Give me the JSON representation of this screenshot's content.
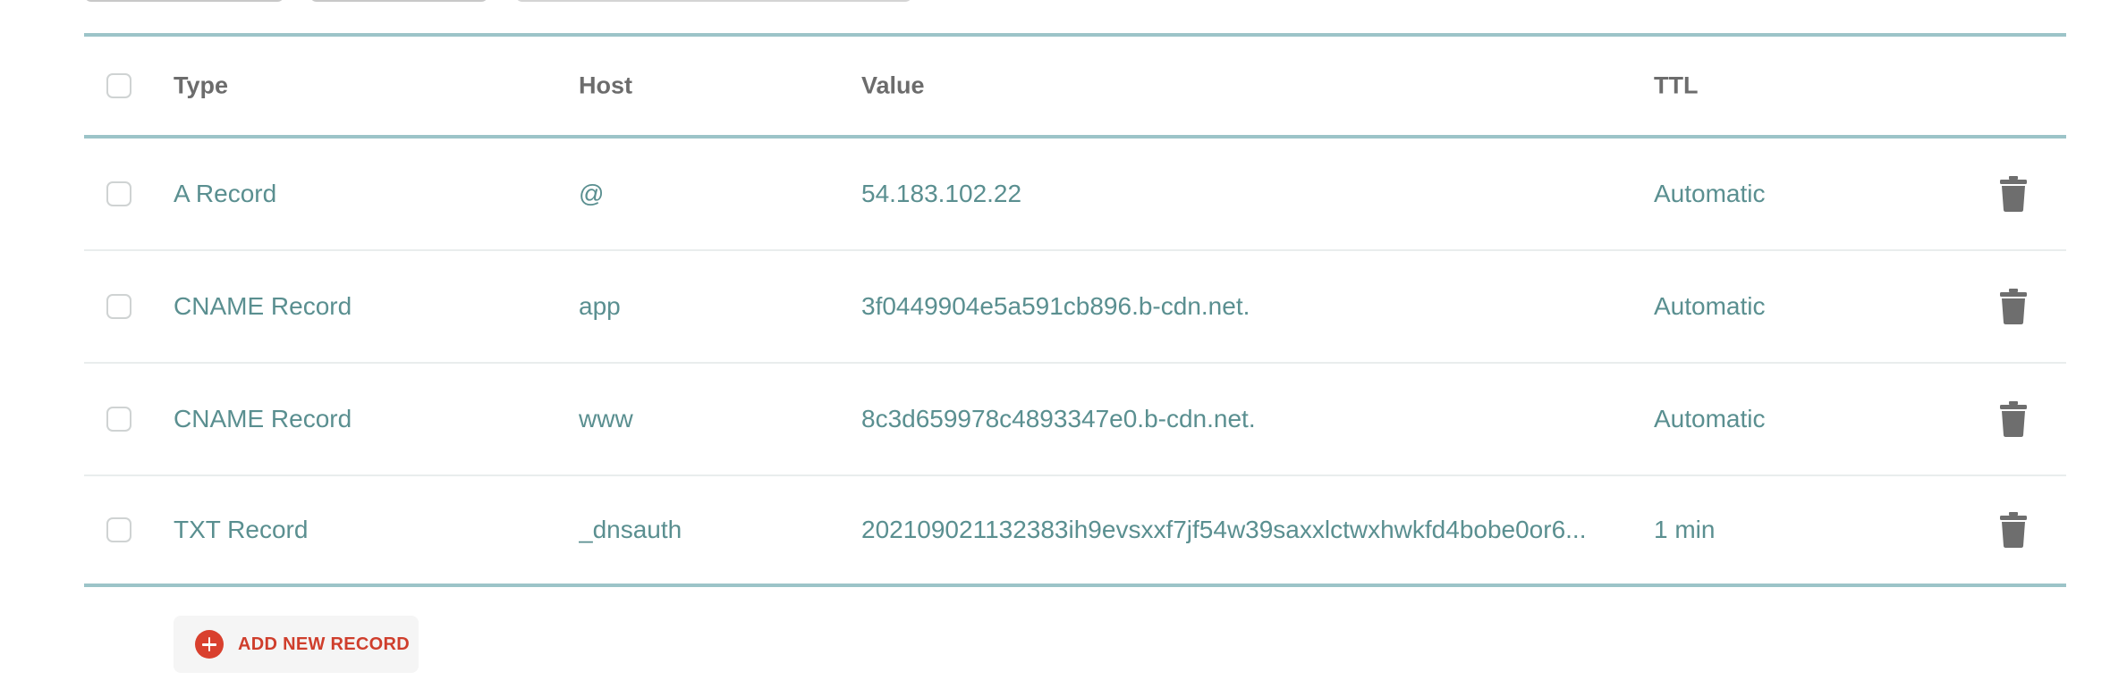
{
  "table": {
    "headers": {
      "type": "Type",
      "host": "Host",
      "value": "Value",
      "ttl": "TTL"
    },
    "rows": [
      {
        "type": "A Record",
        "host": "@",
        "value": "54.183.102.22",
        "ttl": "Automatic"
      },
      {
        "type": "CNAME Record",
        "host": "app",
        "value": "3f0449904e5a591cb896.b-cdn.net.",
        "ttl": "Automatic"
      },
      {
        "type": "CNAME Record",
        "host": "www",
        "value": "8c3d659978c4893347e0.b-cdn.net.",
        "ttl": "Automatic"
      },
      {
        "type": "TXT Record",
        "host": "_dnsauth",
        "value": "202109021132383ih9evsxxf7jf54w39saxxlctwxhwkfd4bobe0or6...",
        "ttl": "1 min"
      }
    ]
  },
  "actions": {
    "add_record_label": "ADD NEW RECORD",
    "add_icon": "plus-circle-icon",
    "delete_icon": "trash-icon"
  },
  "colors": {
    "accent_red": "#d9402e",
    "value_teal": "#5a8f90",
    "header_gray": "#6c6c6c",
    "divider_teal": "#9cc4c8"
  }
}
